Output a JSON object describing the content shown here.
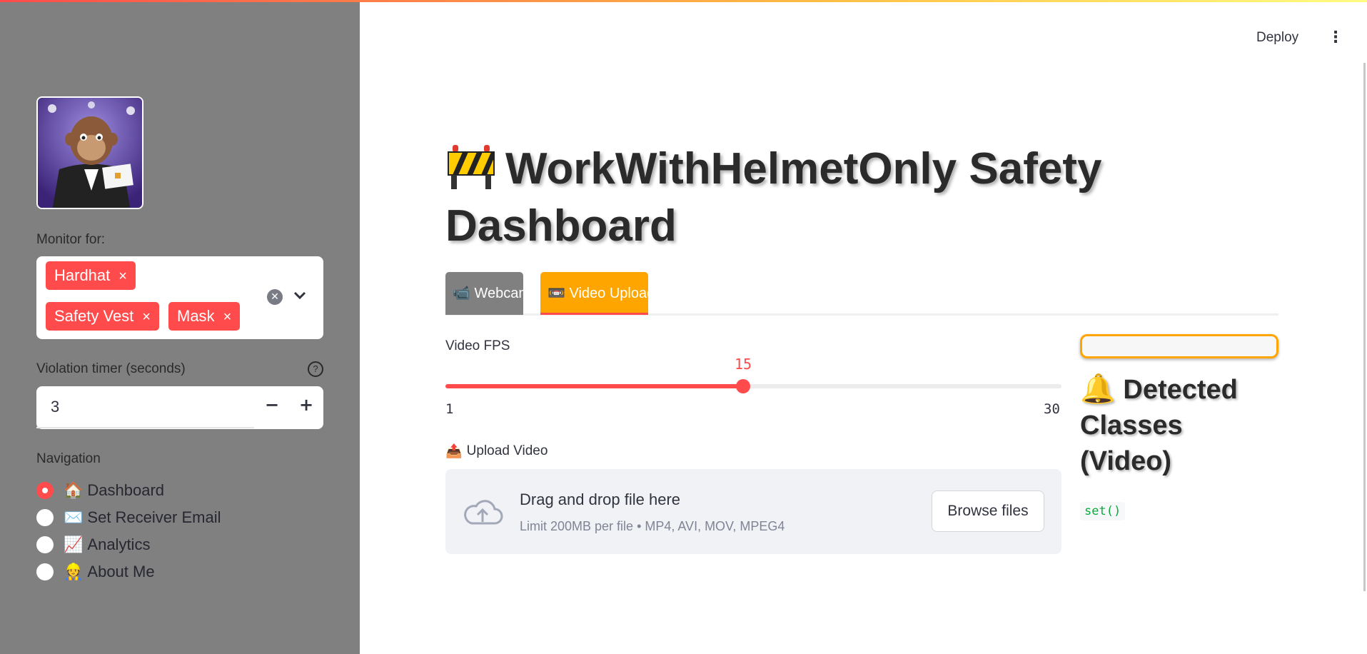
{
  "sidebar": {
    "monitor_label": "Monitor for:",
    "monitor_chips": [
      {
        "label": "Hardhat",
        "remove": "×"
      },
      {
        "label": "Safety Vest",
        "remove": "×"
      },
      {
        "label": "Mask",
        "remove": "×"
      }
    ],
    "clear_icon": "clear-icon",
    "dropdown_icon": "chevron-down-icon",
    "violation_label": "Violation timer (seconds)",
    "violation_help": "?",
    "violation_value": "3",
    "minus": "−",
    "plus": "+",
    "navigation_label": "Navigation",
    "nav_items": [
      {
        "emoji": "🏠",
        "label": "Dashboard",
        "selected": true
      },
      {
        "emoji": "✉️",
        "label": "Set Receiver Email",
        "selected": false
      },
      {
        "emoji": "📈",
        "label": "Analytics",
        "selected": false
      },
      {
        "emoji": "👷",
        "label": "About Me",
        "selected": false
      }
    ]
  },
  "header": {
    "deploy_label": "Deploy",
    "menu_icon": "⋮"
  },
  "main": {
    "title": "WorkWithHelmetOnly Safety Dashboard",
    "tabs": [
      {
        "emoji": "📹",
        "label": "Webcam"
      },
      {
        "emoji": "📼",
        "label": "Video Upload"
      }
    ],
    "fps": {
      "label": "Video FPS",
      "value": 15,
      "min": 1,
      "max": 30
    },
    "upload": {
      "emoji": "📤",
      "label": "Upload Video",
      "drag_text": "Drag and drop file here",
      "limit_text": "Limit 200MB per file • MP4, AVI, MOV, MPEG4",
      "browse_label": "Browse files"
    },
    "detected": {
      "emoji": "🔔",
      "title": "Detected Classes (Video)",
      "value": "set()"
    }
  },
  "colors": {
    "accent": "#ff4b4b",
    "tab_active": "#ffa500",
    "sidebar_bg": "#808080"
  }
}
